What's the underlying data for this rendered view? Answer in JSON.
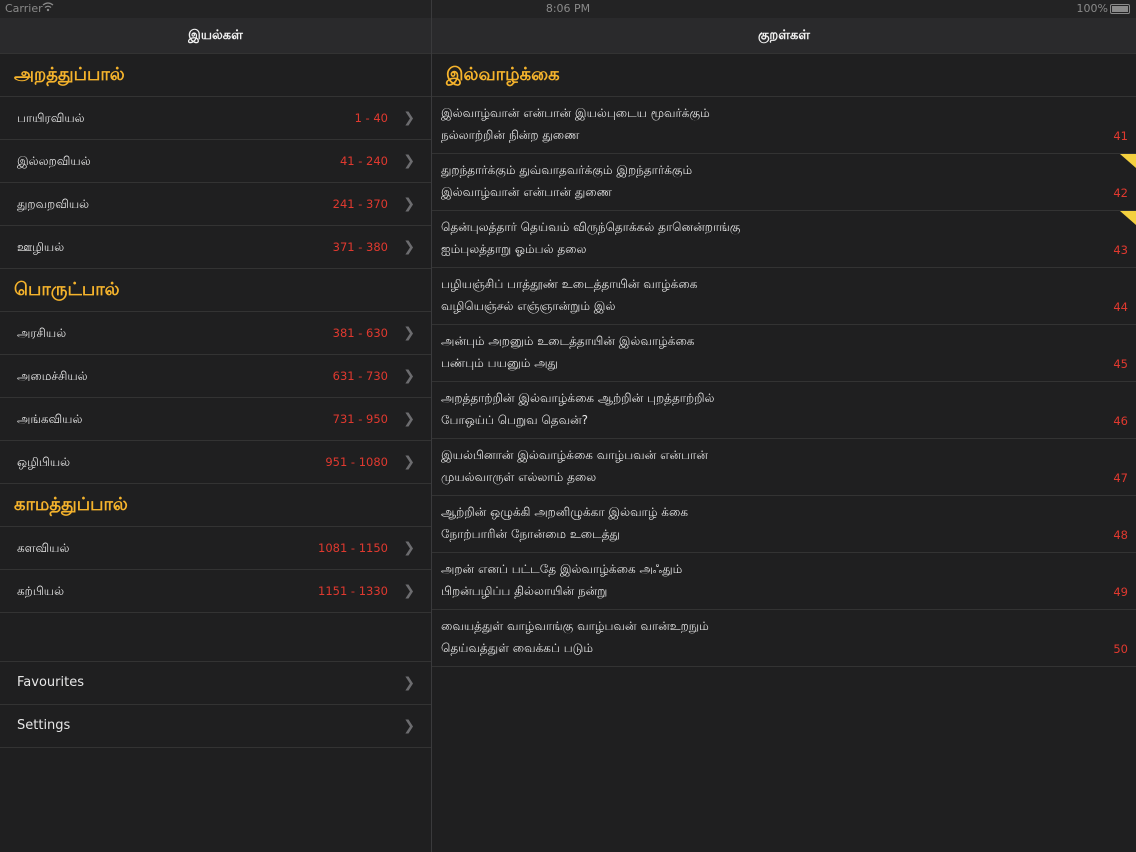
{
  "status": {
    "carrier": "Carrier",
    "time": "8:06 PM",
    "battery": "100%"
  },
  "left": {
    "title": "இயல்கள்",
    "sections": [
      {
        "title": "அறத்துப்பால்",
        "items": [
          {
            "label": "பாயிரவியல்",
            "range": "1 - 40"
          },
          {
            "label": "இல்லறவியல்",
            "range": "41 - 240"
          },
          {
            "label": "துறவறவியல்",
            "range": "241 - 370"
          },
          {
            "label": "ஊழியல்",
            "range": "371 - 380"
          }
        ]
      },
      {
        "title": "பொருட்பால்",
        "items": [
          {
            "label": "அரசியல்",
            "range": "381 - 630"
          },
          {
            "label": "அமைச்சியல்",
            "range": "631 - 730"
          },
          {
            "label": "அங்கவியல்",
            "range": "731 - 950"
          },
          {
            "label": "ஒழிபியல்",
            "range": "951 - 1080"
          }
        ]
      },
      {
        "title": "காமத்துப்பால்",
        "items": [
          {
            "label": "களவியல்",
            "range": "1081 - 1150"
          },
          {
            "label": "கற்பியல்",
            "range": "1151 - 1330"
          }
        ]
      }
    ],
    "extras": [
      {
        "label": "Favourites"
      },
      {
        "label": "Settings"
      }
    ]
  },
  "right": {
    "title": "குறள்கள்",
    "chapter": "இல்வாழ்க்கை",
    "kurals": [
      {
        "line1": "இல்வாழ்வான் என்பான் இயல்புடைய மூவர்க்கும்",
        "line2": "நல்லாற்றின் நின்ற துணை",
        "num": "41",
        "flag": false
      },
      {
        "line1": "துறந்தார்க்கும் துவ்வாதவர்க்கும் இறந்தார்க்கும்",
        "line2": "இல்வாழ்வான் என்பான் துணை",
        "num": "42",
        "flag": true
      },
      {
        "line1": "தென்புலத்தார் தெய்வம் விருந்தொக்கல் தானென்றாங்கு",
        "line2": "ஐம்புலத்தாறு ஓம்பல் தலை",
        "num": "43",
        "flag": true
      },
      {
        "line1": "பழியஞ்சிப் பாத்தூண் உடைத்தாயின் வாழ்க்கை",
        "line2": "வழியெஞ்சல் எஞ்ஞான்றும் இல்",
        "num": "44",
        "flag": false
      },
      {
        "line1": "அன்பும் அறனும் உடைத்தாயின் இல்வாழ்க்கை",
        "line2": "பண்பும் பயனும் அது",
        "num": "45",
        "flag": false
      },
      {
        "line1": "அறத்தாற்றின் இல்வாழ்க்கை ஆற்றின் புறத்தாற்றில்",
        "line2": "போஒய்ப் பெறுவ தெவன்?",
        "num": "46",
        "flag": false
      },
      {
        "line1": "இயல்பினான் இல்வாழ்க்கை வாழ்பவன் என்பான்",
        "line2": "முயல்வாருள் எல்லாம் தலை",
        "num": "47",
        "flag": false
      },
      {
        "line1": "ஆற்றின் ஒழுக்கி அறனிழுக்கா இல்வாழ் க்கை",
        "line2": "நோற்பாரின் நோன்மை உடைத்து",
        "num": "48",
        "flag": false
      },
      {
        "line1": "அறன் எனப் பட்டதே இல்வாழ்க்கை அஃதும்",
        "line2": "பிறன்பழிப்ப தில்லாயின் நன்று",
        "num": "49",
        "flag": false
      },
      {
        "line1": "வையத்துள் வாழ்வாங்கு வாழ்பவன் வான்உறநும்",
        "line2": "தெய்வத்துள் வைக்கப் படும்",
        "num": "50",
        "flag": false
      }
    ]
  },
  "colors": {
    "accent": "#f5b32c",
    "number": "#e0392f",
    "flag": "#f4d03f",
    "background": "#1f1f20"
  }
}
